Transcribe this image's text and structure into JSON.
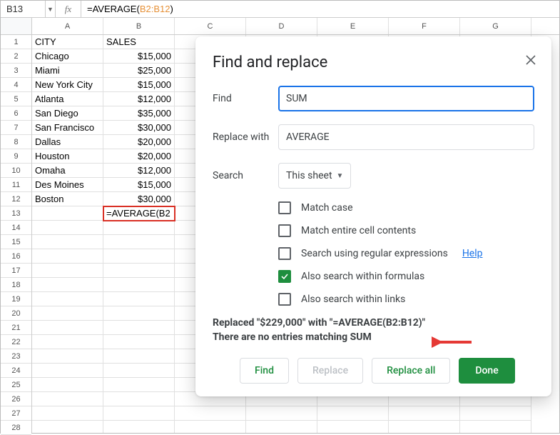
{
  "formula_bar": {
    "cell_ref": "B13",
    "fx_label": "fx",
    "formula_prefix": "=AVERAGE(",
    "formula_range": "B2:B12",
    "formula_suffix": ")"
  },
  "columns": [
    "A",
    "B",
    "C",
    "D",
    "E",
    "F",
    "G"
  ],
  "row_count": 28,
  "header_row": {
    "a": "CITY",
    "b": "SALES"
  },
  "data_rows": [
    {
      "city": "Chicago",
      "sales": "$15,000"
    },
    {
      "city": "Miami",
      "sales": "$25,000"
    },
    {
      "city": "New York City",
      "sales": "$15,000"
    },
    {
      "city": "Atlanta",
      "sales": "$12,000"
    },
    {
      "city": "San Diego",
      "sales": "$35,000"
    },
    {
      "city": "San Francisco",
      "sales": "$30,000"
    },
    {
      "city": "Dallas",
      "sales": "$20,000"
    },
    {
      "city": "Houston",
      "sales": "$20,000"
    },
    {
      "city": "Omaha",
      "sales": "$12,000"
    },
    {
      "city": "Des Moines",
      "sales": "$15,000"
    },
    {
      "city": "Boston",
      "sales": "$30,000"
    }
  ],
  "selected_cell_display": "=AVERAGE(B2",
  "dialog": {
    "title": "Find and replace",
    "find_label": "Find",
    "find_value": "SUM",
    "replace_label": "Replace with",
    "replace_value": "AVERAGE",
    "search_label": "Search",
    "search_scope": "This sheet",
    "options": {
      "match_case": "Match case",
      "match_entire": "Match entire cell contents",
      "regex": "Search using regular expressions",
      "regex_help": "Help",
      "within_formulas": "Also search within formulas",
      "within_links": "Also search within links"
    },
    "checked": {
      "within_formulas": true
    },
    "status_line1": "Replaced \"$229,000\" with \"=AVERAGE(B2:B12)\"",
    "status_line2": "There are no entries matching SUM",
    "buttons": {
      "find": "Find",
      "replace": "Replace",
      "replace_all": "Replace all",
      "done": "Done"
    }
  }
}
